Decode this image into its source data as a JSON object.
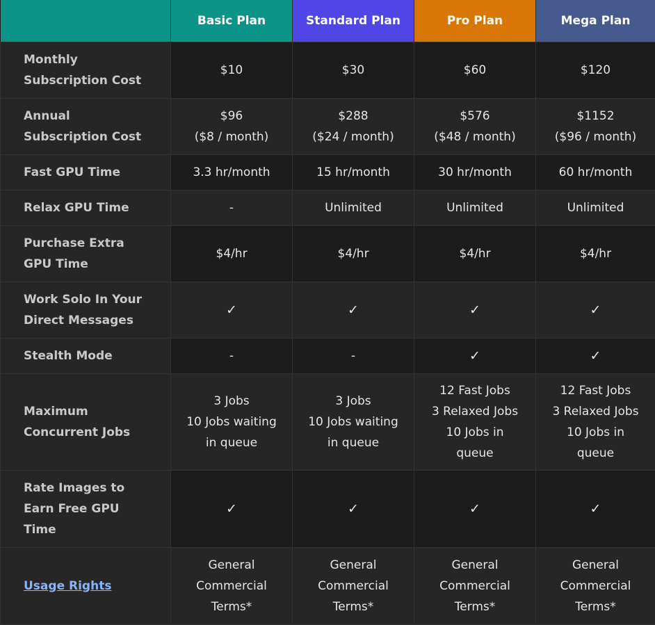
{
  "colors": {
    "basic": "#0d9488",
    "standard": "#4f46e5",
    "pro": "#d97706",
    "mega": "#475a8f",
    "link": "#8ab4f8"
  },
  "plans": [
    "Basic Plan",
    "Standard Plan",
    "Pro Plan",
    "Mega Plan"
  ],
  "rows": [
    {
      "label": [
        "Monthly",
        "Subscription Cost"
      ],
      "values": [
        [
          "$10"
        ],
        [
          "$30"
        ],
        [
          "$60"
        ],
        [
          "$120"
        ]
      ]
    },
    {
      "label": [
        "Annual",
        "Subscription Cost"
      ],
      "values": [
        [
          "$96",
          "($8 / month)"
        ],
        [
          "$288",
          "($24 / month)"
        ],
        [
          "$576",
          "($48 / month)"
        ],
        [
          "$1152",
          "($96 / month)"
        ]
      ]
    },
    {
      "label": [
        "Fast GPU Time"
      ],
      "values": [
        [
          "3.3 hr/month"
        ],
        [
          "15 hr/month"
        ],
        [
          "30 hr/month"
        ],
        [
          "60 hr/month"
        ]
      ]
    },
    {
      "label": [
        "Relax GPU Time"
      ],
      "values": [
        [
          "-"
        ],
        [
          "Unlimited"
        ],
        [
          "Unlimited"
        ],
        [
          "Unlimited"
        ]
      ]
    },
    {
      "label": [
        "Purchase Extra",
        "GPU Time"
      ],
      "values": [
        [
          "$4/hr"
        ],
        [
          "$4/hr"
        ],
        [
          "$4/hr"
        ],
        [
          "$4/hr"
        ]
      ]
    },
    {
      "label": [
        "Work Solo In Your",
        "Direct Messages"
      ],
      "values": [
        [
          "✓"
        ],
        [
          "✓"
        ],
        [
          "✓"
        ],
        [
          "✓"
        ]
      ]
    },
    {
      "label": [
        "Stealth Mode"
      ],
      "values": [
        [
          "-"
        ],
        [
          "-"
        ],
        [
          "✓"
        ],
        [
          "✓"
        ]
      ]
    },
    {
      "label": [
        "Maximum",
        "Concurrent Jobs"
      ],
      "values": [
        [
          "3 Jobs",
          "10 Jobs waiting",
          "in queue"
        ],
        [
          "3 Jobs",
          "10 Jobs waiting",
          "in queue"
        ],
        [
          "12 Fast Jobs",
          "3 Relaxed Jobs",
          "10 Jobs in",
          "queue"
        ],
        [
          "12 Fast Jobs",
          "3 Relaxed Jobs",
          "10 Jobs in",
          "queue"
        ]
      ]
    },
    {
      "label": [
        "Rate Images to",
        "Earn Free GPU",
        "Time"
      ],
      "values": [
        [
          "✓"
        ],
        [
          "✓"
        ],
        [
          "✓"
        ],
        [
          "✓"
        ]
      ]
    },
    {
      "label": [
        "Usage Rights"
      ],
      "link": true,
      "values": [
        [
          "General",
          "Commercial",
          "Terms*"
        ],
        [
          "General",
          "Commercial",
          "Terms*"
        ],
        [
          "General",
          "Commercial",
          "Terms*"
        ],
        [
          "General",
          "Commercial",
          "Terms*"
        ]
      ]
    }
  ]
}
